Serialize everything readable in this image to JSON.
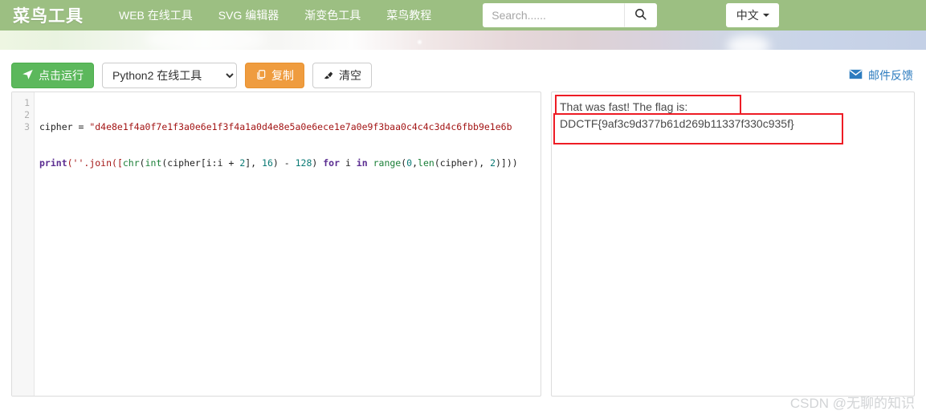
{
  "navbar": {
    "brand": "菜鸟工具",
    "links": [
      {
        "label": "WEB 在线工具"
      },
      {
        "label": "SVG 编辑器"
      },
      {
        "label": "渐变色工具"
      },
      {
        "label": "菜鸟教程"
      }
    ],
    "search": {
      "placeholder": "Search......",
      "value": "",
      "icon": "search-icon"
    },
    "language": {
      "label": "中文",
      "icon": "caret-down-icon"
    },
    "background_color": "#9cbf82"
  },
  "toolbar": {
    "run_label": "点击运行",
    "run_icon": "paper-plane-icon",
    "run_color": "#5cb85c",
    "language_select": {
      "value": "Python2 在线工具",
      "options": [
        "Python2 在线工具"
      ]
    },
    "copy_label": "复制",
    "copy_icon": "copy-icon",
    "copy_color": "#ef9c3f",
    "clear_label": "清空",
    "clear_icon": "eraser-icon",
    "feedback_label": "邮件反馈",
    "feedback_icon": "envelope-icon",
    "feedback_color": "#2d7cbf"
  },
  "editor": {
    "line_numbers": [
      "1",
      "2",
      "3"
    ],
    "line1": {
      "var": "cipher = ",
      "string": "\"d4e8e1f4a0f7e1f3a0e6e1f3f4a1a0d4e8e5a0e6ece1e7a0e9f3baa0c4c4c3d4c6fbb9e1e6b"
    },
    "line2": {
      "kw_print": "print",
      "p1": "('",
      "p2": "'.join([",
      "chr": "chr",
      "p3": "(",
      "int": "int",
      "p4": "(cipher[i:i + ",
      "n2": "2",
      "p5": "], ",
      "n16": "16",
      "p6": ") - ",
      "n128": "128",
      "p7": ") ",
      "kw_for": "for",
      "p8": " i ",
      "kw_in": "in",
      "p9": " ",
      "range": "range",
      "p10": "(",
      "n0": "0",
      "p11": ",",
      "len": "len",
      "p12": "(cipher), ",
      "n2b": "2",
      "p13": ")]))"
    }
  },
  "output": {
    "lines": [
      "That was fast! The flag is:",
      "DDCTF{9af3c9d377b61d269b11337f330c935f}"
    ],
    "annotation_color": "#ee1c25"
  },
  "watermark": {
    "text": "CSDN @无聊的知识"
  }
}
